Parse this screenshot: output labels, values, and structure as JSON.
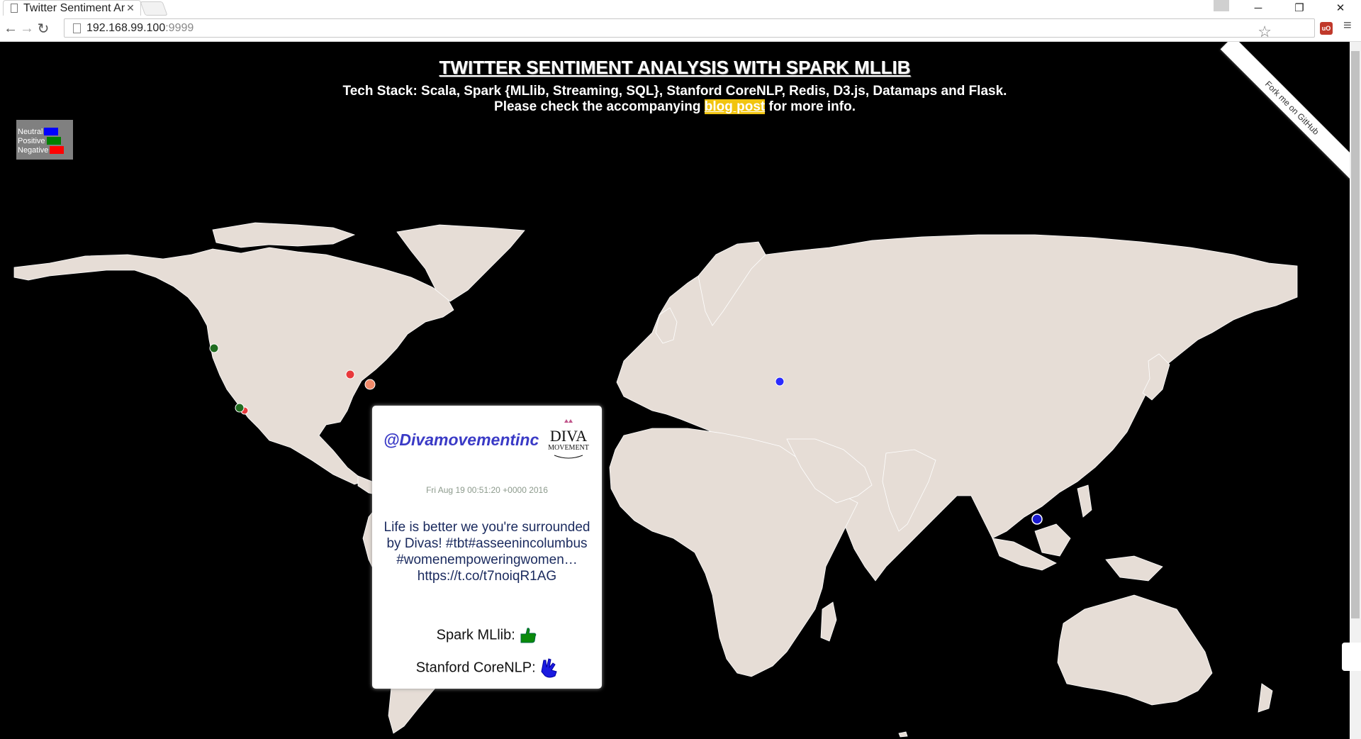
{
  "browser": {
    "tab_title": "Twitter Sentiment An",
    "url_host": "192.168.99.100",
    "url_port": ":9999"
  },
  "header": {
    "title": "TWITTER SENTIMENT ANALYSIS WITH SPARK MLLIB",
    "tech_stack": "Tech Stack: Scala, Spark {MLlib, Streaming, SQL}, Stanford CoreNLP, Redis, D3.js, Datamaps and Flask.",
    "info_prefix": "Please check the accompanying ",
    "info_link": "blog post",
    "info_suffix": " for more info."
  },
  "legend": {
    "items": [
      {
        "label": "Neutral",
        "color": "#0000ff"
      },
      {
        "label": "Positive",
        "color": "#008000"
      },
      {
        "label": "Negative",
        "color": "#ff0000"
      }
    ]
  },
  "fork_ribbon": "Fork me on GitHub",
  "colors": {
    "land": "#e6ddd6",
    "ocean": "#000000",
    "neutral": "#2b2bff",
    "positive": "#1f6b1f",
    "negative": "#e8393c"
  },
  "tweet": {
    "handle": "@Divamovementinc",
    "avatar_text": [
      "DIVA",
      "MOVEMENT"
    ],
    "date": "Fri Aug 19 00:51:20 +0000 2016",
    "text": "Life is better we you're surrounded by Divas! #tbt#asseenincolumbus #womenempoweringwomen… https://t.co/t7noiqR1AG",
    "spark_label": "Spark MLlib:",
    "spark_icon": "thumbs-up-hand-icon",
    "nlp_label": "Stanford CoreNLP:",
    "nlp_icon": "ok-hand-icon"
  }
}
